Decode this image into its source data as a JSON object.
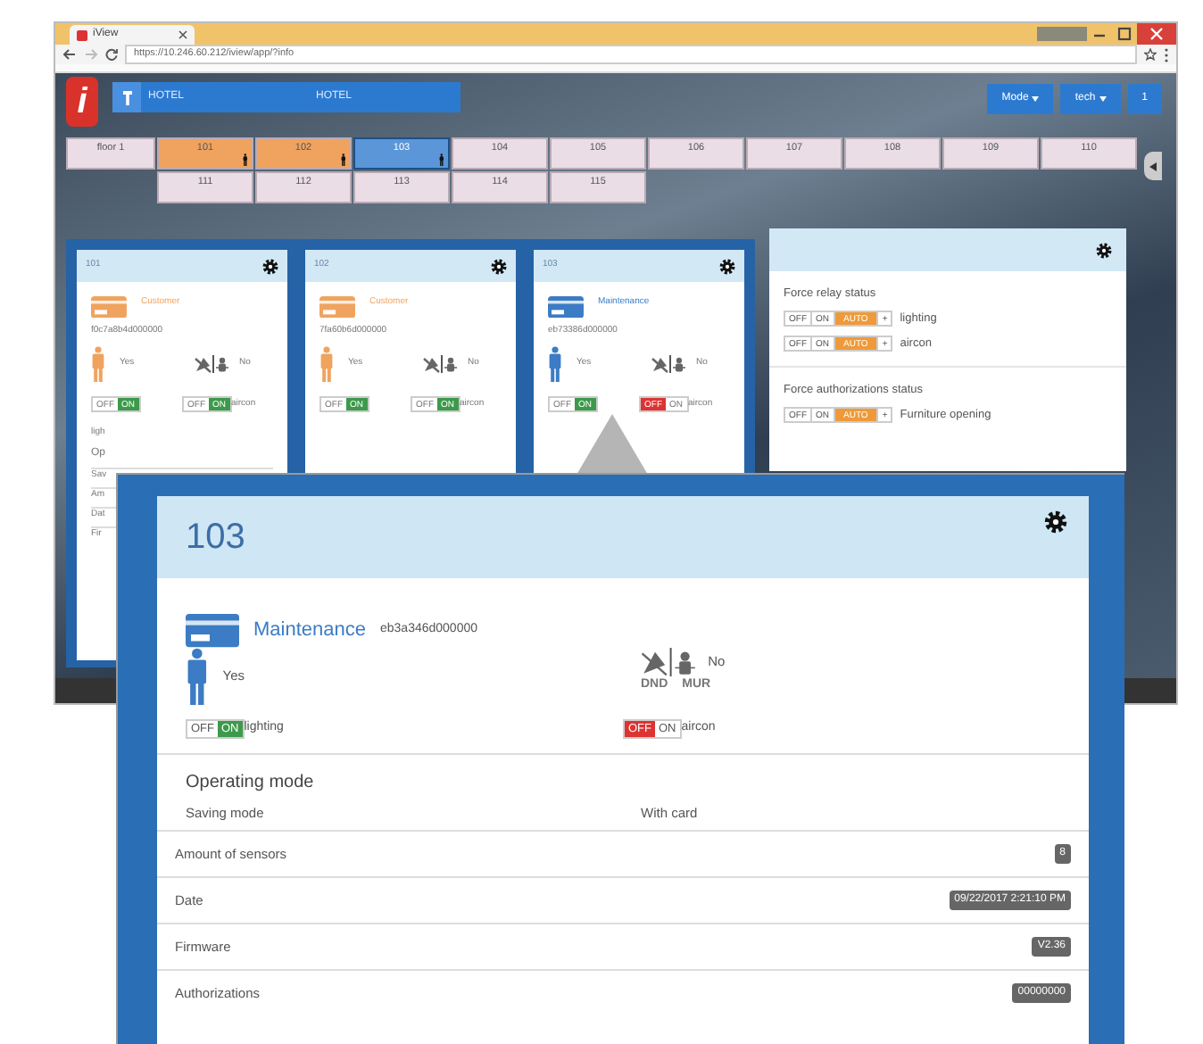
{
  "browser": {
    "tab_title": "iView",
    "url": "https://10.246.60.212/iview/app/?info"
  },
  "navbar": {
    "logo_text": "i",
    "breadcrumb": [
      "HOTEL",
      "HOTEL"
    ],
    "menus": [
      {
        "label": "Mode",
        "dropdown": true
      },
      {
        "label": "tech",
        "dropdown": true
      },
      {
        "label": "1",
        "dropdown": false
      }
    ]
  },
  "floor": {
    "label": "floor 1",
    "rooms": [
      {
        "number": "101",
        "kind": "customer",
        "presence": true,
        "selected": false
      },
      {
        "number": "102",
        "kind": "customer",
        "presence": true,
        "selected": false
      },
      {
        "number": "103",
        "kind": "maintenance",
        "presence": true,
        "selected": true
      },
      {
        "number": "104",
        "kind": "empty",
        "presence": false,
        "selected": false
      },
      {
        "number": "105",
        "kind": "empty",
        "presence": false,
        "selected": false
      },
      {
        "number": "106",
        "kind": "empty",
        "presence": false,
        "selected": false
      },
      {
        "number": "107",
        "kind": "empty",
        "presence": false,
        "selected": false
      },
      {
        "number": "108",
        "kind": "empty",
        "presence": false,
        "selected": false
      },
      {
        "number": "109",
        "kind": "empty",
        "presence": false,
        "selected": false
      },
      {
        "number": "110",
        "kind": "empty",
        "presence": false,
        "selected": false
      },
      {
        "number": "111",
        "kind": "empty",
        "presence": false,
        "selected": false
      },
      {
        "number": "112",
        "kind": "empty",
        "presence": false,
        "selected": false
      },
      {
        "number": "113",
        "kind": "empty",
        "presence": false,
        "selected": false
      },
      {
        "number": "114",
        "kind": "empty",
        "presence": false,
        "selected": false
      },
      {
        "number": "115",
        "kind": "empty",
        "presence": false,
        "selected": false
      }
    ]
  },
  "room_cards": [
    {
      "number": "101",
      "kind": "customer",
      "card_label": "Customer",
      "card_id": "f0c7a8b4d000000",
      "presence": "Yes",
      "dnd_mur": "No",
      "toggles": [
        {
          "off_text": "OFF",
          "on_text": "ON",
          "on": true
        },
        {
          "off_text": "OFF",
          "on_text": "ON",
          "on": true,
          "label": "aircon"
        }
      ],
      "cut_lines": [
        "ligh",
        "Op",
        "Sav",
        "Am",
        "Dat",
        "Fir"
      ]
    },
    {
      "number": "102",
      "kind": "customer",
      "card_label": "Customer",
      "card_id": "7fa60b6d000000",
      "presence": "Yes",
      "dnd_mur": "No",
      "toggles": [
        {
          "off_text": "OFF",
          "on_text": "ON",
          "on": true
        },
        {
          "off_text": "OFF",
          "on_text": "ON",
          "on": true,
          "label": "aircon"
        }
      ]
    },
    {
      "number": "103",
      "kind": "maintenance",
      "card_label": "Maintenance",
      "card_id": "eb73386d000000",
      "presence": "Yes",
      "dnd_mur": "No",
      "toggles": [
        {
          "off_text": "OFF",
          "on_text": "ON",
          "on": true
        },
        {
          "off_text": "OFF",
          "on_text": "ON",
          "on": false,
          "label": "aircon"
        }
      ]
    }
  ],
  "force_panel": {
    "sections": [
      {
        "title": "Force relay status",
        "rows": [
          {
            "options": [
              {
                "label": "OFF",
                "selected": false
              },
              {
                "label": "ON",
                "selected": false
              },
              {
                "label": "AUTO",
                "selected": true
              }
            ],
            "plus": "+",
            "label": "lighting"
          },
          {
            "options": [
              {
                "label": "OFF",
                "selected": false
              },
              {
                "label": "ON",
                "selected": false
              },
              {
                "label": "AUTO",
                "selected": true
              }
            ],
            "plus": "+",
            "label": "aircon"
          }
        ]
      },
      {
        "title": "Force authorizations status",
        "rows": [
          {
            "options": [
              {
                "label": "OFF",
                "selected": false
              },
              {
                "label": "ON",
                "selected": false
              },
              {
                "label": "AUTO",
                "selected": true
              }
            ],
            "plus": "+",
            "label": "Furniture opening"
          }
        ]
      }
    ]
  },
  "detail": {
    "number": "103",
    "kind": "maintenance",
    "card_label": "Maintenance",
    "card_id": "eb3a346d000000",
    "presence": "Yes",
    "dnd_mur": "No",
    "dnd_label": "DND",
    "mur_label": "MUR",
    "toggles": [
      {
        "off_text": "OFF",
        "on_text": "ON",
        "on": true,
        "label": "lighting"
      },
      {
        "off_text": "OFF",
        "on_text": "ON",
        "on": false,
        "label": "aircon"
      }
    ],
    "operating_mode": {
      "title": "Operating mode",
      "name": "Saving mode",
      "value": "With card"
    },
    "info_rows": [
      {
        "label": "Amount of sensors",
        "value": "8"
      },
      {
        "label": "Date",
        "value": "09/22/2017 2:21:10 PM"
      },
      {
        "label": "Firmware",
        "value": "V2.36"
      },
      {
        "label": "Authorizations",
        "value": "00000000"
      }
    ]
  }
}
